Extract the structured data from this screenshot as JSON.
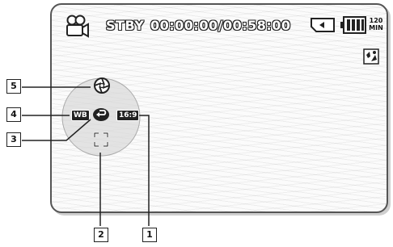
{
  "osd": {
    "status": "STBY",
    "timecode": "00:00:00/00:58:00",
    "remaining_top": "120",
    "remaining_bottom": "MIN"
  },
  "wheel": {
    "left_label": "WB",
    "right_label": "16:9"
  },
  "callouts": [
    "1",
    "2",
    "3",
    "4",
    "5"
  ],
  "icons": {
    "camera_mode": "camcorder-icon",
    "storage": "memory-card-icon",
    "battery": "battery-icon",
    "scene": "scene-mode-icon",
    "top_item": "aperture-icon",
    "center": "return-icon",
    "bottom": "focus-frame-icon"
  }
}
